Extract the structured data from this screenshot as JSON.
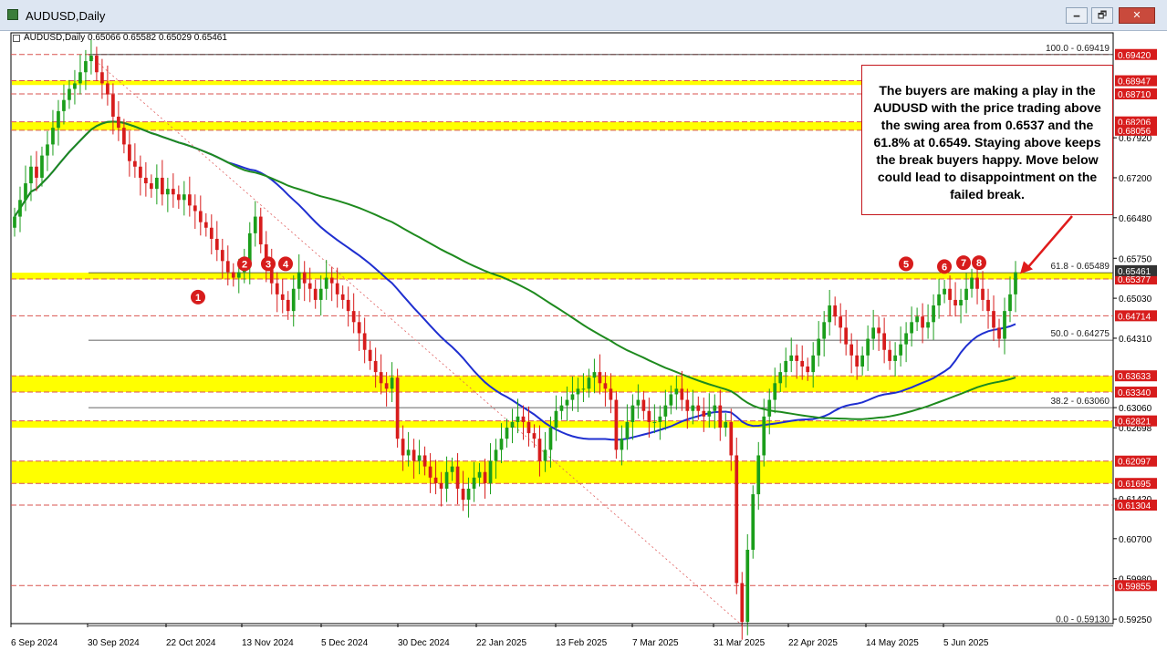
{
  "window": {
    "title": "AUDUSD,Daily",
    "minimize_label": "🗕",
    "restore_label": "🗗",
    "close_label": "✕"
  },
  "ohlc_label": "AUDUSD,Daily  0.65066 0.65582 0.65029 0.65461",
  "annotation": "The buyers are making a play in the AUDUSD with the price trading above the swing area from 0.6537 and the 61.8% at 0.6549.  Staying above keeps the break buyers happy. Move below could lead to disappointment on the failed break.",
  "colors": {
    "bull": "#1b9e1b",
    "bear": "#d71c1c",
    "ma_blue": "#1f2fd0",
    "ma_green": "#1e8a1e",
    "zone": "#ffff00",
    "level_line": "#d9534f",
    "badge": "#d71c1c",
    "price_tag": "#d71c1c",
    "current_tag": "#333333"
  },
  "chart_data": {
    "type": "candlestick",
    "symbol": "AUDUSD",
    "timeframe": "Daily",
    "ylim": [
      0.5917,
      0.6981
    ],
    "x_tick_labels": [
      "6 Sep 2024",
      "30 Sep 2024",
      "22 Oct 2024",
      "13 Nov 2024",
      "5 Dec 2024",
      "30 Dec 2024",
      "22 Jan 2025",
      "13 Feb 2025",
      "7 Mar 2025",
      "31 Mar 2025",
      "22 Apr 2025",
      "14 May 2025",
      "5 Jun 2025"
    ],
    "y_axis_labels": [
      "0.67920",
      "0.67200",
      "0.66480",
      "0.65750",
      "0.65030",
      "0.64310",
      "0.63060",
      "0.62698",
      "0.61420",
      "0.60700",
      "0.59980",
      "0.59250"
    ],
    "price_tags": [
      "0.69420",
      "0.68947",
      "0.68710",
      "0.68206",
      "0.68056",
      "0.65377",
      "0.64714",
      "0.63633",
      "0.63340",
      "0.62821",
      "0.62097",
      "0.61695",
      "0.61304",
      "0.59855"
    ],
    "current_price": "0.65461",
    "level_lines": [
      0.6942,
      0.68947,
      0.6871,
      0.68206,
      0.68056,
      0.65377,
      0.64714,
      0.63633,
      0.6334,
      0.62821,
      0.62097,
      0.61695,
      0.61304,
      0.59855
    ],
    "zones": [
      {
        "from": 0.6887,
        "to": 0.6895
      },
      {
        "from": 0.68056,
        "to": 0.68206
      },
      {
        "from": 0.6537,
        "to": 0.6549
      },
      {
        "from": 0.6334,
        "to": 0.63633
      },
      {
        "from": 0.62698,
        "to": 0.62821
      },
      {
        "from": 0.61695,
        "to": 0.62097
      }
    ],
    "fibonacci": [
      {
        "label": "100.0 - 0.69419",
        "value": 0.69419
      },
      {
        "label": "61.8 - 0.65489",
        "value": 0.65489
      },
      {
        "label": "50.0 - 0.64275",
        "value": 0.64275
      },
      {
        "label": "38.2 - 0.63060",
        "value": 0.6306
      },
      {
        "label": "0.0 - 0.59130",
        "value": 0.5913
      }
    ],
    "swing_markers": [
      {
        "label": "1",
        "value": 0.6505
      },
      {
        "label": "2",
        "value": 0.6565
      },
      {
        "label": "3",
        "value": 0.6565
      },
      {
        "label": "4",
        "value": 0.6565
      },
      {
        "label": "5",
        "value": 0.6565
      },
      {
        "label": "6",
        "value": 0.656
      },
      {
        "label": "7",
        "value": 0.6567
      },
      {
        "label": "8",
        "value": 0.6567
      }
    ],
    "price_path": [
      0.665,
      0.668,
      0.671,
      0.674,
      0.672,
      0.676,
      0.678,
      0.681,
      0.684,
      0.686,
      0.688,
      0.689,
      0.691,
      0.693,
      0.694,
      0.691,
      0.689,
      0.687,
      0.683,
      0.681,
      0.678,
      0.675,
      0.674,
      0.672,
      0.671,
      0.67,
      0.672,
      0.669,
      0.67,
      0.669,
      0.668,
      0.669,
      0.667,
      0.666,
      0.664,
      0.663,
      0.661,
      0.659,
      0.657,
      0.655,
      0.654,
      0.655,
      0.656,
      0.662,
      0.665,
      0.66,
      0.656,
      0.653,
      0.651,
      0.65,
      0.648,
      0.652,
      0.655,
      0.653,
      0.652,
      0.65,
      0.652,
      0.654,
      0.653,
      0.651,
      0.65,
      0.648,
      0.646,
      0.644,
      0.641,
      0.639,
      0.637,
      0.635,
      0.634,
      0.636,
      0.625,
      0.622,
      0.623,
      0.621,
      0.622,
      0.62,
      0.618,
      0.617,
      0.616,
      0.619,
      0.62,
      0.616,
      0.614,
      0.616,
      0.618,
      0.619,
      0.617,
      0.621,
      0.623,
      0.625,
      0.627,
      0.628,
      0.629,
      0.628,
      0.626,
      0.625,
      0.621,
      0.623,
      0.627,
      0.63,
      0.631,
      0.632,
      0.633,
      0.634,
      0.634,
      0.636,
      0.637,
      0.635,
      0.634,
      0.632,
      0.623,
      0.625,
      0.628,
      0.631,
      0.632,
      0.63,
      0.628,
      0.628,
      0.629,
      0.631,
      0.633,
      0.634,
      0.632,
      0.63,
      0.631,
      0.63,
      0.629,
      0.63,
      0.631,
      0.627,
      0.628,
      0.622,
      0.599,
      0.592,
      0.605,
      0.615,
      0.622,
      0.629,
      0.632,
      0.635,
      0.637,
      0.639,
      0.64,
      0.639,
      0.638,
      0.637,
      0.64,
      0.643,
      0.646,
      0.649,
      0.647,
      0.645,
      0.642,
      0.64,
      0.638,
      0.64,
      0.643,
      0.645,
      0.644,
      0.641,
      0.639,
      0.64,
      0.642,
      0.644,
      0.646,
      0.647,
      0.645,
      0.646,
      0.649,
      0.651,
      0.652,
      0.65,
      0.649,
      0.65,
      0.652,
      0.654,
      0.652,
      0.65,
      0.648,
      0.645,
      0.643,
      0.648,
      0.651,
      0.655
    ]
  }
}
